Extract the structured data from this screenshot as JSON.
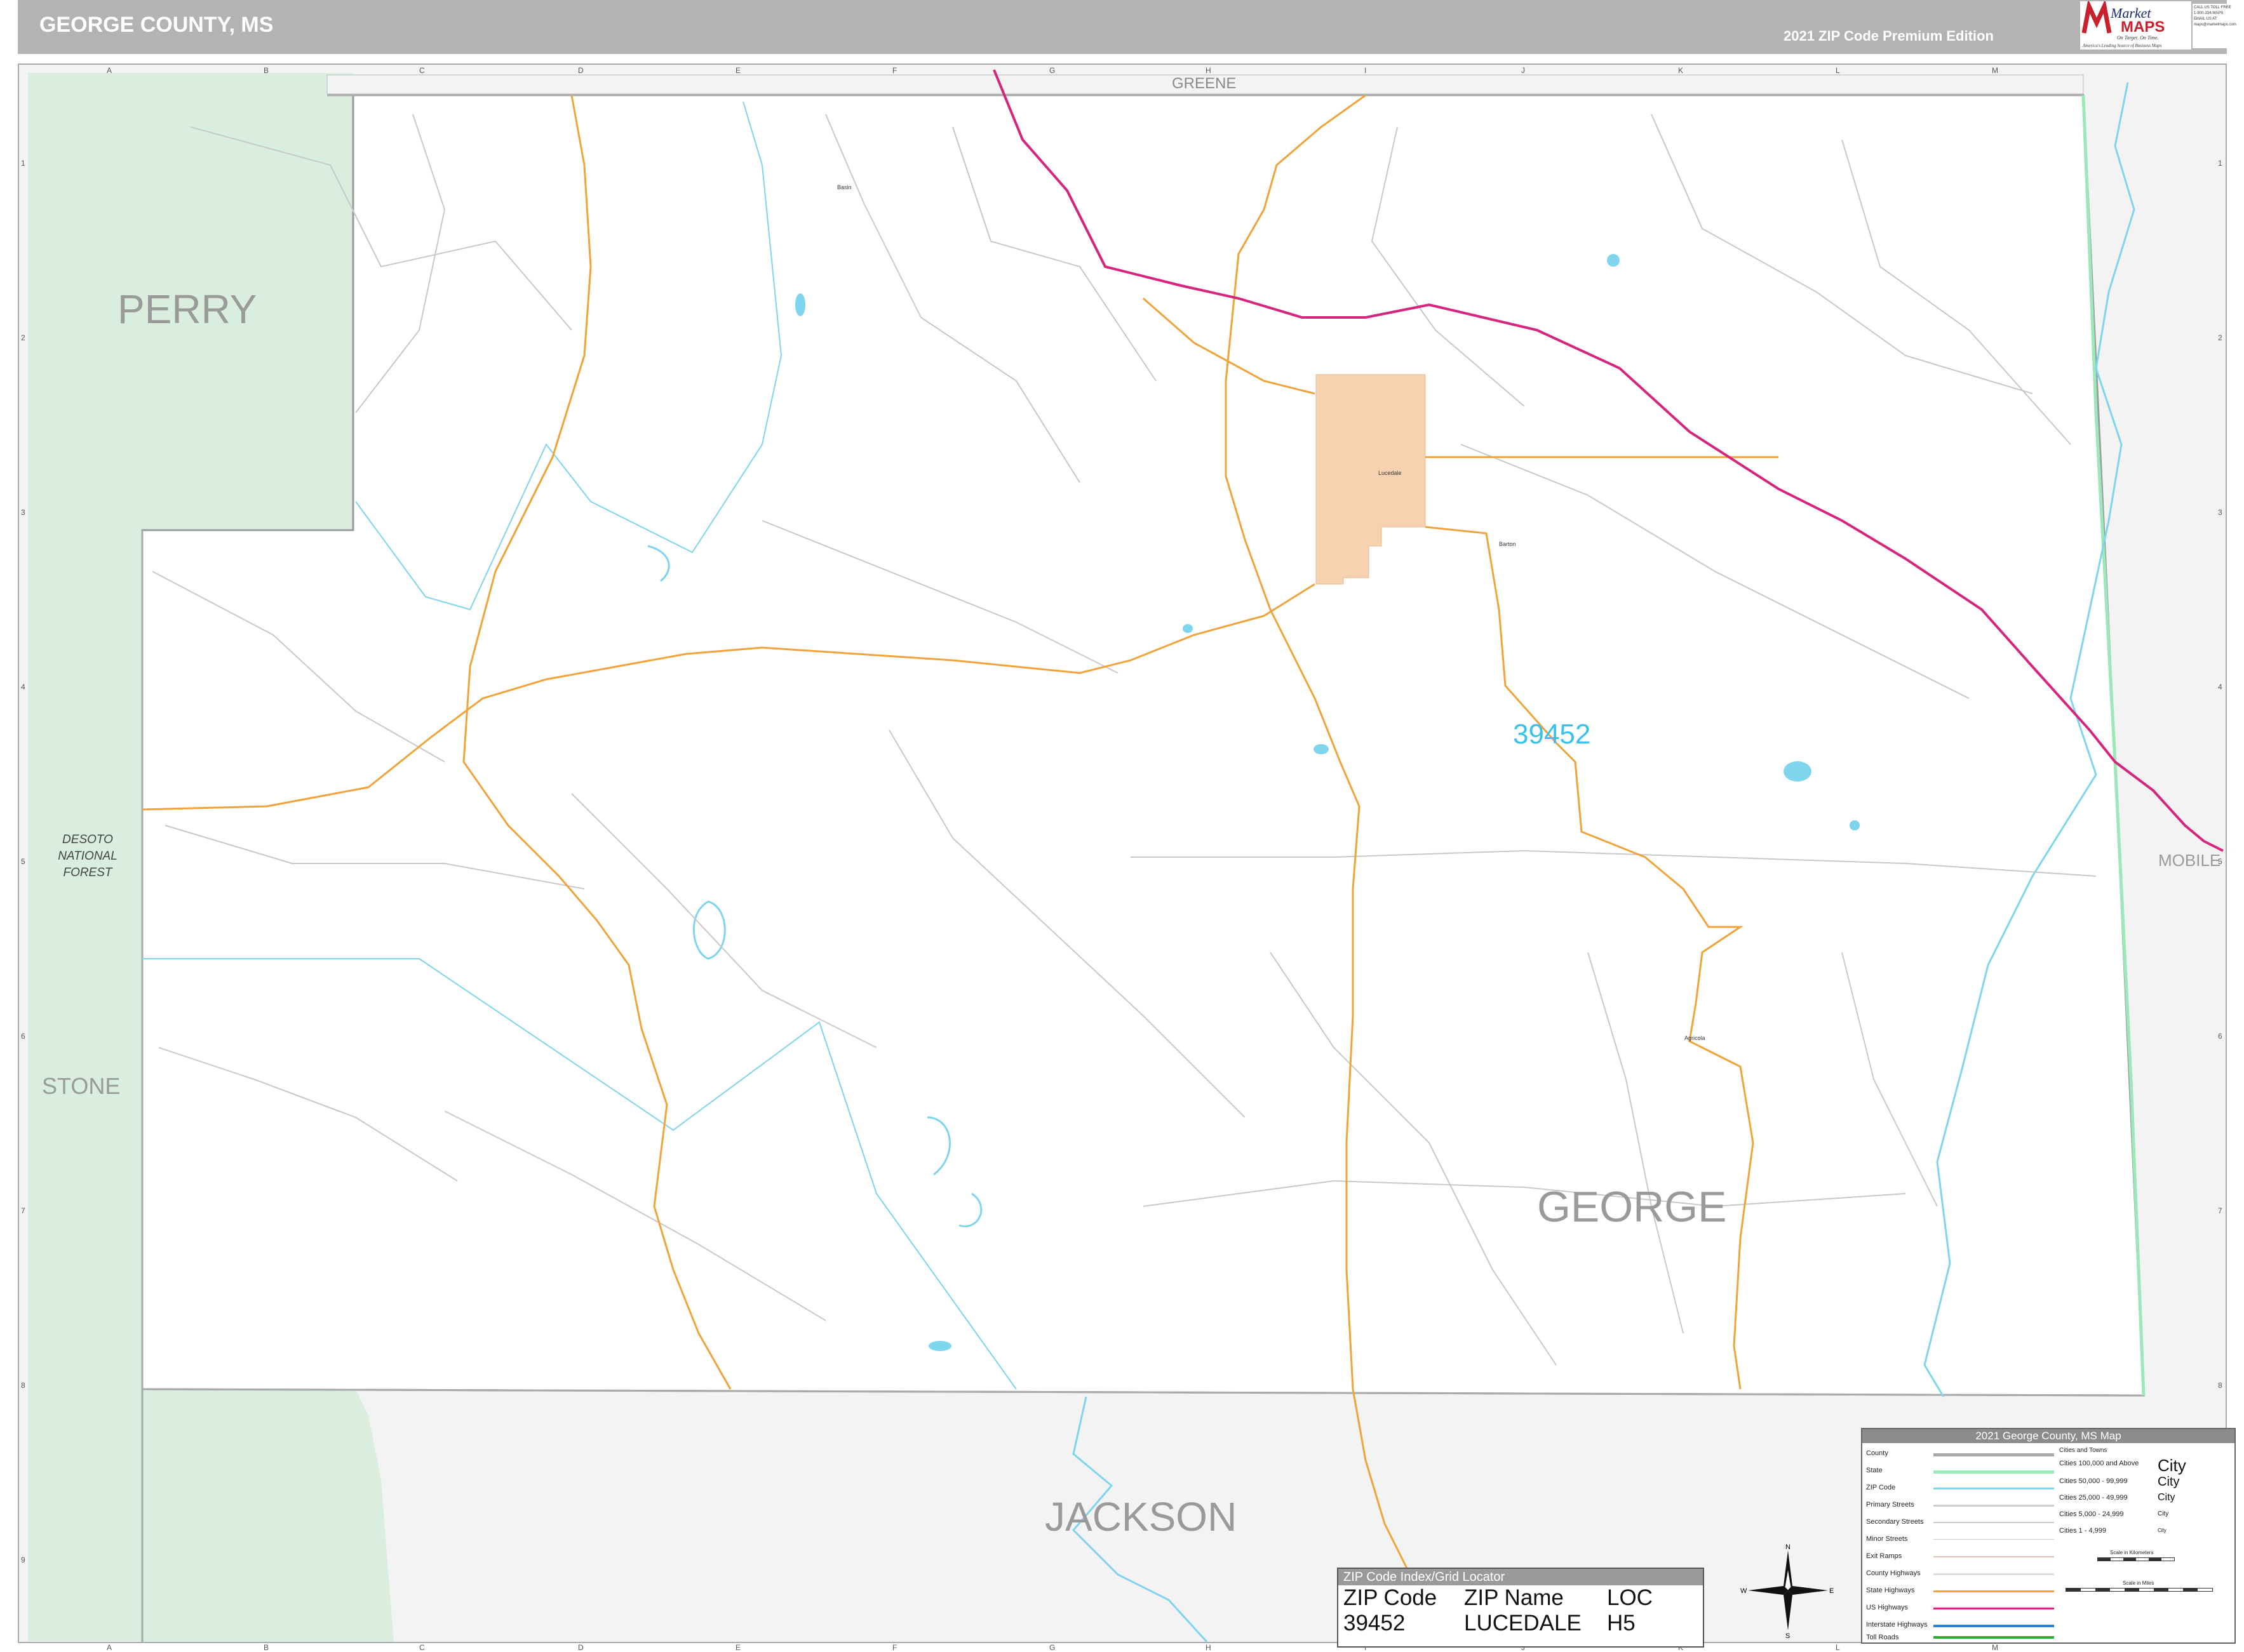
{
  "header": {
    "title": "GEORGE COUNTY, MS",
    "edition": "2021 ZIP Code Premium Edition",
    "logo_word1": "Market",
    "logo_word2": "MAPS",
    "logo_tagline1": "On Target. On Time.",
    "logo_tagline2": "America's Leading Source of Business Maps",
    "logo_contact": [
      "CALL US TOLL FREE",
      "1-800-334-MAPS",
      "EMAIL US AT:",
      "maps@marketmaps.com"
    ]
  },
  "grid": {
    "columns": [
      "A",
      "B",
      "C",
      "D",
      "E",
      "F",
      "G",
      "H",
      "I",
      "J",
      "K",
      "L",
      "M"
    ],
    "rows": [
      "1",
      "2",
      "3",
      "4",
      "5",
      "6",
      "7",
      "8",
      "9"
    ]
  },
  "regions": {
    "perry": "PERRY",
    "greene": "GREENE",
    "mobile": "MOBILE",
    "stone": "STONE",
    "george": "GEORGE",
    "jackson": "JACKSON",
    "national_forest": [
      "DESOTO",
      "NATIONAL",
      "FOREST"
    ]
  },
  "places": {
    "lucedale": "Lucedale",
    "barton": "Barton",
    "agricola": "Agricola",
    "basin": "Basin"
  },
  "zip_label": "39452",
  "zip_index": {
    "title": "ZIP Code Index/Grid Locator",
    "headers": [
      "ZIP Code",
      "ZIP Name",
      "LOC"
    ],
    "rows": [
      [
        "39452",
        "LUCEDALE",
        "H5"
      ]
    ]
  },
  "compass": {
    "n": "N",
    "s": "S",
    "e": "E",
    "w": "W"
  },
  "legend": {
    "title": "2021 George County, MS Map",
    "items": [
      "County",
      "State",
      "ZIP Code",
      "Primary Streets",
      "Secondary Streets",
      "Minor Streets",
      "Exit Ramps",
      "County Highways",
      "State Highways",
      "US Highways",
      "Interstate Highways",
      "Toll Roads"
    ],
    "cities_title": "Cities and Towns",
    "city_sizes": [
      "Cities 100,000 and Above",
      "Cities 50,000 - 99,999",
      "Cities 25,000 - 49,999",
      "Cities 5,000 - 24,999",
      "Cities 1 - 4,999"
    ],
    "city_marks": [
      "City",
      "City",
      "City",
      "City",
      "City"
    ],
    "scale_km": "Scale in Kilometers",
    "scale_mi": "Scale in Miles"
  },
  "colors": {
    "header_bg": "#b3b3b3",
    "forest": "#d9eedf",
    "outside": "#f2f2f2",
    "zip_text": "#39c2ea",
    "us_highway": "#d6257d",
    "state_highway": "#f0a33a",
    "water": "#7fd4ee",
    "state_line": "#9be8b8",
    "city_fill": "#f7d2b0"
  }
}
